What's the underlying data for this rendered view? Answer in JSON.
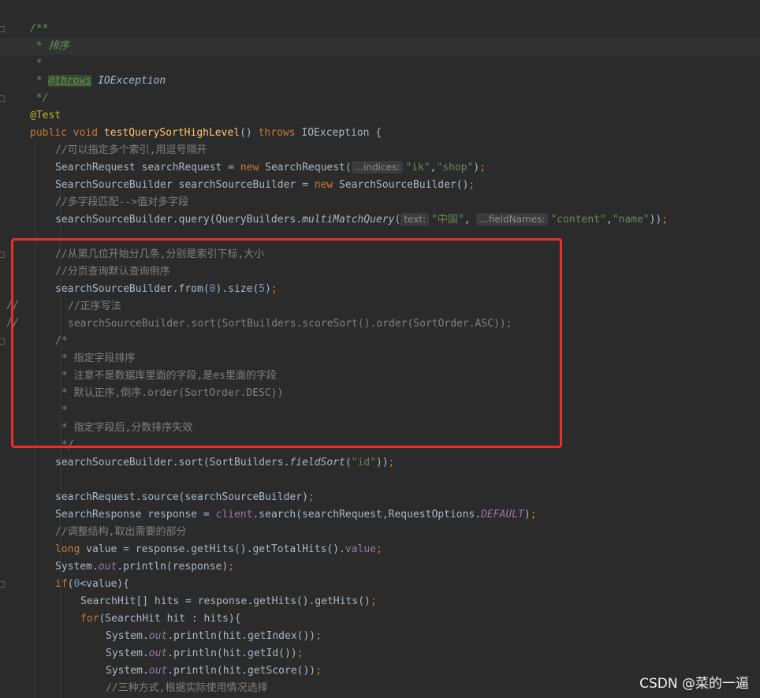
{
  "watermark": "CSDN @菜的一逼",
  "lines": [
    {
      "indent": 38,
      "hl": false,
      "tokens": [
        {
          "t": "/**",
          "c": "doc"
        }
      ]
    },
    {
      "indent": 38,
      "hl": true,
      "tokens": [
        {
          "t": " * 排序",
          "c": "doc"
        }
      ]
    },
    {
      "indent": 38,
      "hl": false,
      "tokens": [
        {
          "t": " *",
          "c": "doc"
        }
      ]
    },
    {
      "indent": 38,
      "hl": false,
      "tokens": [
        {
          "t": " * ",
          "c": "doc"
        },
        {
          "t": "@throws",
          "c": "doctag"
        },
        {
          "t": " IOException",
          "c": "italic"
        }
      ]
    },
    {
      "indent": 38,
      "hl": false,
      "tokens": [
        {
          "t": " */",
          "c": "doc"
        }
      ]
    },
    {
      "indent": 38,
      "hl": false,
      "tokens": [
        {
          "t": "@Test",
          "c": "ann"
        }
      ]
    },
    {
      "indent": 38,
      "hl": false,
      "tokens": [
        {
          "t": "public void ",
          "c": "kw"
        },
        {
          "t": "testQuerySortHighLevel",
          "c": "fn"
        },
        {
          "t": "() "
        },
        {
          "t": "throws ",
          "c": "kw"
        },
        {
          "t": "IOException {"
        }
      ]
    },
    {
      "indent": 70,
      "hl": false,
      "tokens": [
        {
          "t": "//可以指定多个索引,用逗号隔开",
          "c": "comment"
        }
      ]
    },
    {
      "indent": 70,
      "hl": false,
      "tokens": [
        {
          "t": "SearchRequest searchRequest = "
        },
        {
          "t": "new ",
          "c": "kw"
        },
        {
          "t": "SearchRequest("
        },
        {
          "t": "...indices:",
          "c": "hint"
        },
        {
          "t": "\"ik\"",
          "c": "str"
        },
        {
          "t": ","
        },
        {
          "t": "\"shop\"",
          "c": "str"
        },
        {
          "t": ")"
        },
        {
          "t": ";",
          "c": "kw"
        }
      ]
    },
    {
      "indent": 70,
      "hl": false,
      "tokens": [
        {
          "t": "SearchSourceBuilder searchSourceBuilder = "
        },
        {
          "t": "new ",
          "c": "kw"
        },
        {
          "t": "SearchSourceBuilder()"
        },
        {
          "t": ";",
          "c": "kw"
        }
      ]
    },
    {
      "indent": 70,
      "hl": false,
      "tokens": [
        {
          "t": "//多字段匹配-->值对多字段",
          "c": "comment"
        }
      ]
    },
    {
      "indent": 70,
      "hl": false,
      "tokens": [
        {
          "t": "searchSourceBuilder.query(QueryBuilders."
        },
        {
          "t": "multiMatchQuery",
          "c": "italic"
        },
        {
          "t": "("
        },
        {
          "t": "text:",
          "c": "hint"
        },
        {
          "t": "\"中国\"",
          "c": "str"
        },
        {
          "t": ", "
        },
        {
          "t": "...fieldNames:",
          "c": "hint"
        },
        {
          "t": "\"content\"",
          "c": "str"
        },
        {
          "t": ","
        },
        {
          "t": "\"name\"",
          "c": "str"
        },
        {
          "t": "))"
        },
        {
          "t": ";",
          "c": "kw"
        }
      ]
    },
    {
      "indent": 70,
      "hl": false,
      "tokens": []
    },
    {
      "indent": 70,
      "hl": false,
      "tokens": [
        {
          "t": "//从第几位开始分几条,分别是索引下标,大小",
          "c": "comment"
        }
      ]
    },
    {
      "indent": 70,
      "hl": false,
      "tokens": [
        {
          "t": "//分页查询默认查询倒序",
          "c": "comment"
        }
      ]
    },
    {
      "indent": 70,
      "hl": false,
      "tokens": [
        {
          "t": "searchSourceBuilder.from("
        },
        {
          "t": "0",
          "c": "num"
        },
        {
          "t": ").size("
        },
        {
          "t": "5",
          "c": "num"
        },
        {
          "t": ")"
        },
        {
          "t": ";",
          "c": "kw"
        }
      ]
    },
    {
      "indent": 86,
      "hl": false,
      "tokens": [
        {
          "t": "//正序写法",
          "c": "comment"
        }
      ]
    },
    {
      "indent": 86,
      "hl": false,
      "tokens": [
        {
          "t": "searchSourceBuilder.sort(SortBuilders.scoreSort().order(SortOrder.ASC));",
          "c": "comment"
        }
      ]
    },
    {
      "indent": 70,
      "hl": false,
      "tokens": [
        {
          "t": "/*",
          "c": "comment"
        }
      ]
    },
    {
      "indent": 70,
      "hl": false,
      "tokens": [
        {
          "t": " * 指定字段排序",
          "c": "comment"
        }
      ]
    },
    {
      "indent": 70,
      "hl": false,
      "tokens": [
        {
          "t": " * 注意不是数据库里面的字段,是es里面的字段",
          "c": "comment"
        }
      ]
    },
    {
      "indent": 70,
      "hl": false,
      "tokens": [
        {
          "t": " * 默认正序,倒序.order(SortOrder.DESC))",
          "c": "comment"
        }
      ]
    },
    {
      "indent": 70,
      "hl": false,
      "tokens": [
        {
          "t": " *",
          "c": "comment"
        }
      ]
    },
    {
      "indent": 70,
      "hl": false,
      "tokens": [
        {
          "t": " * 指定字段后,分数排序失效",
          "c": "comment"
        }
      ]
    },
    {
      "indent": 70,
      "hl": false,
      "tokens": [
        {
          "t": " */",
          "c": "comment"
        }
      ]
    },
    {
      "indent": 70,
      "hl": false,
      "tokens": [
        {
          "t": "searchSourceBuilder.sort(SortBuilders."
        },
        {
          "t": "fieldSort",
          "c": "italic"
        },
        {
          "t": "("
        },
        {
          "t": "\"id\"",
          "c": "str"
        },
        {
          "t": "))"
        },
        {
          "t": ";",
          "c": "kw"
        }
      ]
    },
    {
      "indent": 70,
      "hl": false,
      "tokens": []
    },
    {
      "indent": 70,
      "hl": false,
      "tokens": [
        {
          "t": "searchRequest.source(searchSourceBuilder)"
        },
        {
          "t": ";",
          "c": "kw"
        }
      ]
    },
    {
      "indent": 70,
      "hl": false,
      "tokens": [
        {
          "t": "SearchResponse response = "
        },
        {
          "t": "client",
          "c": "field"
        },
        {
          "t": ".search(searchRequest,RequestOptions."
        },
        {
          "t": "DEFAULT",
          "c": "sfield"
        },
        {
          "t": ")"
        },
        {
          "t": ";",
          "c": "kw"
        }
      ]
    },
    {
      "indent": 70,
      "hl": false,
      "tokens": [
        {
          "t": "//调整结构,取出需要的部分",
          "c": "comment"
        }
      ]
    },
    {
      "indent": 70,
      "hl": false,
      "tokens": [
        {
          "t": "long ",
          "c": "kw"
        },
        {
          "t": "value = response.getHits().getTotalHits()."
        },
        {
          "t": "value",
          "c": "field"
        },
        {
          "t": ";",
          "c": "kw"
        }
      ]
    },
    {
      "indent": 70,
      "hl": false,
      "tokens": [
        {
          "t": "System."
        },
        {
          "t": "out",
          "c": "sfield"
        },
        {
          "t": ".println(response)"
        },
        {
          "t": ";",
          "c": "kw"
        }
      ]
    },
    {
      "indent": 70,
      "hl": false,
      "tokens": [
        {
          "t": "if",
          "c": "kw"
        },
        {
          "t": "("
        },
        {
          "t": "0",
          "c": "num"
        },
        {
          "t": "<value){"
        }
      ]
    },
    {
      "indent": 102,
      "hl": false,
      "tokens": [
        {
          "t": "SearchHit[] hits = response.getHits().getHits()"
        },
        {
          "t": ";",
          "c": "kw"
        }
      ]
    },
    {
      "indent": 102,
      "hl": false,
      "tokens": [
        {
          "t": "for",
          "c": "kw"
        },
        {
          "t": "(SearchHit hit : hits){"
        }
      ]
    },
    {
      "indent": 134,
      "hl": false,
      "tokens": [
        {
          "t": "System."
        },
        {
          "t": "out",
          "c": "sfield"
        },
        {
          "t": ".println(hit.getIndex())"
        },
        {
          "t": ";",
          "c": "kw"
        }
      ]
    },
    {
      "indent": 134,
      "hl": false,
      "tokens": [
        {
          "t": "System."
        },
        {
          "t": "out",
          "c": "sfield"
        },
        {
          "t": ".println(hit.getId())"
        },
        {
          "t": ";",
          "c": "kw"
        }
      ]
    },
    {
      "indent": 134,
      "hl": false,
      "tokens": [
        {
          "t": "System."
        },
        {
          "t": "out",
          "c": "sfield"
        },
        {
          "t": ".println(hit.getScore())"
        },
        {
          "t": ";",
          "c": "kw"
        }
      ]
    },
    {
      "indent": 134,
      "hl": false,
      "tokens": [
        {
          "t": "//三种方式,根据实际使用情况选择",
          "c": "comment"
        }
      ]
    }
  ]
}
